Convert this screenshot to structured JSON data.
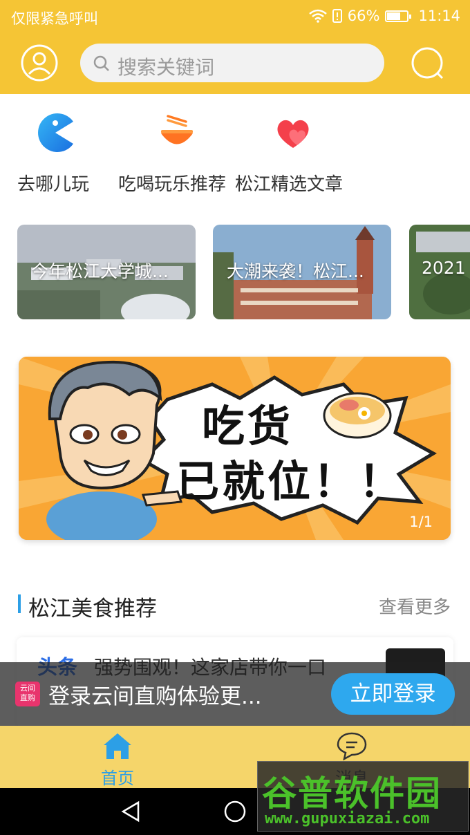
{
  "status_bar": {
    "carrier": "仅限紧急呼叫",
    "battery": "66%",
    "time": "11:14"
  },
  "header": {
    "search_placeholder": "搜索关键词"
  },
  "quick_nav": [
    {
      "label": "去哪儿玩",
      "icon": "pacman-icon"
    },
    {
      "label": "吃喝玩乐推荐",
      "icon": "noodle-bowl-icon"
    },
    {
      "label": "松江精选文章",
      "icon": "heart-icon"
    }
  ],
  "article_cards": [
    {
      "title": "今年松江大学城..."
    },
    {
      "title": "大潮来袭！松江..."
    },
    {
      "title": "2021"
    }
  ],
  "banner": {
    "headline_line1": "吃货",
    "headline_line2": "已就位！！",
    "counter": "1/1"
  },
  "section": {
    "title": "松江美食推荐",
    "more": "查看更多"
  },
  "news_item": {
    "tag": "头条",
    "headline": "强势围观！这家店带你一口"
  },
  "login_prompt": {
    "logo_line1": "云间",
    "logo_line2": "直购",
    "text": "登录云间直购体验更...",
    "button": "立即登录"
  },
  "tabbar": [
    {
      "label": "首页",
      "icon": "home-icon",
      "active": true
    },
    {
      "label": "消息",
      "icon": "message-icon",
      "active": false
    }
  ],
  "watermark": {
    "title": "谷普软件园",
    "url": "www.gupuxiazai.com"
  },
  "colors": {
    "brand_yellow": "#f5c535",
    "accent_blue": "#2c9fe6",
    "tab_active": "#2c9fe6"
  }
}
